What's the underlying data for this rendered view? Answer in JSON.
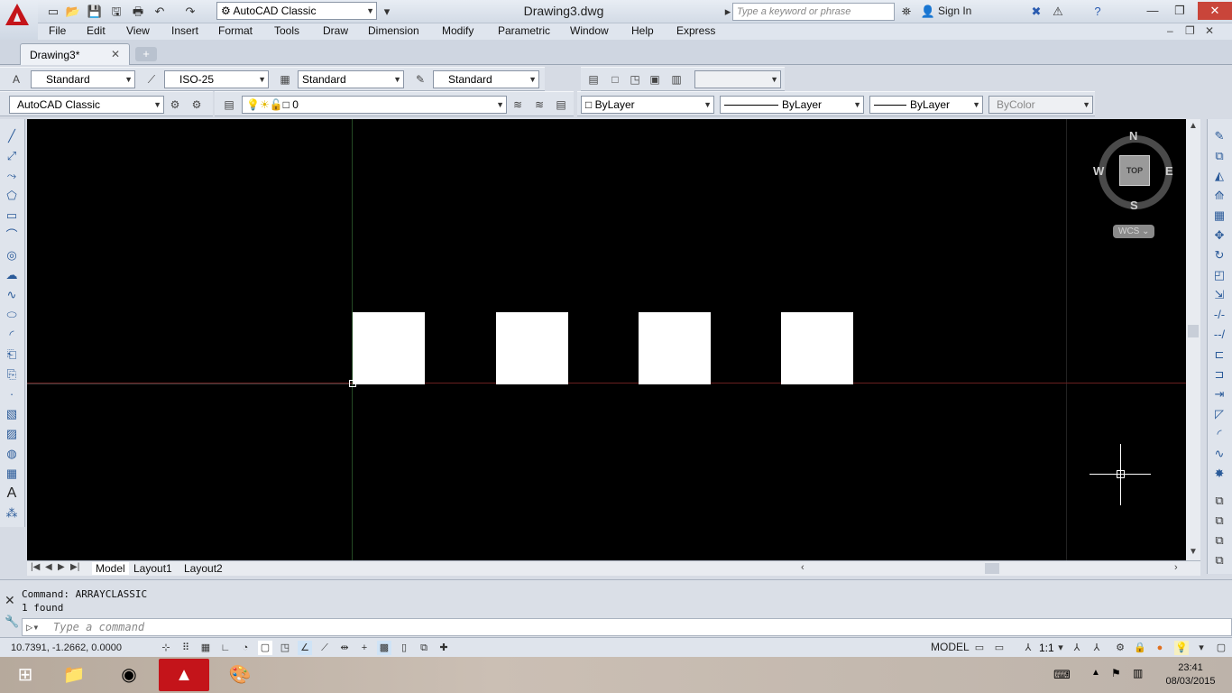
{
  "titlebar": {
    "workspace": "AutoCAD Classic",
    "document_title": "Drawing3.dwg",
    "search_placeholder": "Type a keyword or phrase",
    "sign_in": "Sign In"
  },
  "menu": [
    "File",
    "Edit",
    "View",
    "Insert",
    "Format",
    "Tools",
    "Draw",
    "Dimension",
    "Modify",
    "Parametric",
    "Window",
    "Help",
    "Express"
  ],
  "tab": {
    "label": "Drawing3*",
    "close": "✕",
    "new": "+"
  },
  "styles_toolbar": {
    "text_style": "Standard",
    "dim_style": "ISO-25",
    "table_style": "Standard",
    "multileader_style": "Standard"
  },
  "workspace_toolbar": {
    "workspace": "AutoCAD Classic"
  },
  "layers_toolbar": {
    "current_layer": "0"
  },
  "properties_toolbar": {
    "color": "ByLayer",
    "linetype": "ByLayer",
    "lineweight": "ByLayer",
    "plot_style": "ByColor"
  },
  "viewcube": {
    "top": "TOP",
    "north": "N",
    "south": "S",
    "east": "E",
    "west": "W",
    "wcs": "WCS"
  },
  "layout_tabs": [
    "Model",
    "Layout1",
    "Layout2"
  ],
  "command": {
    "history": [
      "Command: ARRAYCLASSIC",
      "1 found"
    ],
    "placeholder": "Type a command"
  },
  "status": {
    "coordinates": "10.7391, -1.2662, 0.0000",
    "model": "MODEL",
    "scale": "1:1"
  },
  "taskbar": {
    "time": "23:41",
    "date": "08/03/2015"
  },
  "colors": {
    "canvas": "#000000",
    "close_button": "#c9453a",
    "logo": "#c4141a"
  }
}
